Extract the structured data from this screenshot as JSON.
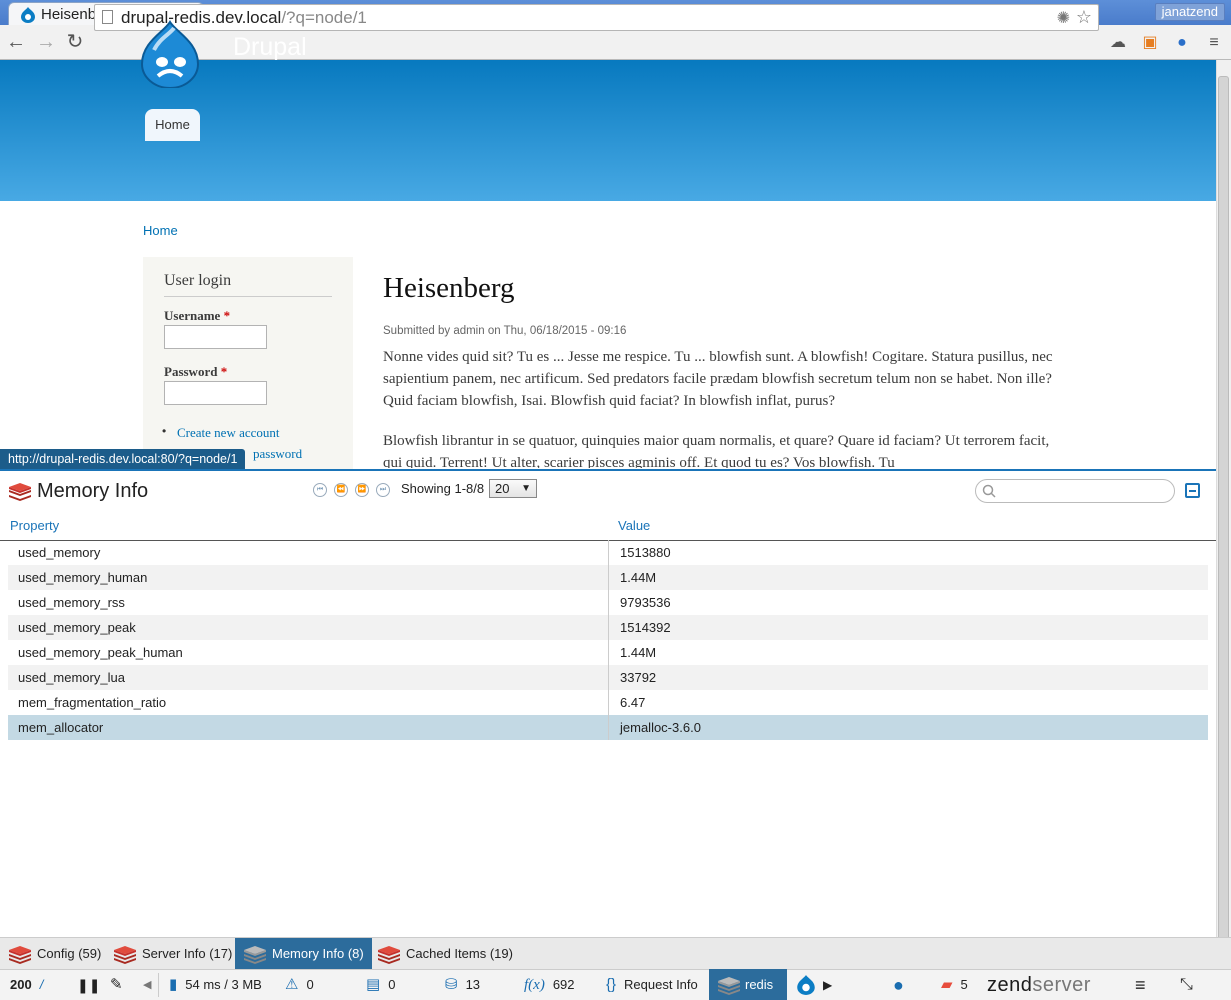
{
  "browser": {
    "tab_title": "Heisenberg | Drupal",
    "user": "janatzend",
    "url_host": "drupal-redis.dev.local",
    "url_path": "/?q=node/1"
  },
  "site": {
    "name": "Drupal",
    "nav_home": "Home",
    "breadcrumb": "Home"
  },
  "login": {
    "title": "User login",
    "username_label": "Username",
    "password_label": "Password",
    "required_mark": "*",
    "create_account": "Create new account",
    "request_password": "password"
  },
  "node": {
    "title": "Heisenberg",
    "submitted": "Submitted by admin on Thu, 06/18/2015 - 09:16",
    "para1": "Nonne vides quid sit? Tu es ... Jesse me respice. Tu ... blowfish sunt. A blowfish! Cogitare. Statura pusillus, nec sapientium panem, nec artificum. Sed predators facile prædam blowfish secretum telum non se habet. Non ille? Quid faciam blowfish, Isai. Blowfish quid faciat? In blowfish inflat, purus?",
    "para2": "Blowfish librantur in se quatuor, quinquies maior quam normalis, et quare? Quare id faciam? Ut terrorem facit, qui quid. Terrent! Ut alter, scarier pisces agminis off. Et quod tu es? Vos blowfish. Tu"
  },
  "status_url": "http://drupal-redis.dev.local:80/?q=node/1",
  "panel": {
    "title": "Memory Info",
    "showing": "Showing 1-8/8",
    "per_page": "20",
    "col_property": "Property",
    "col_value": "Value",
    "rows": [
      {
        "property": "used_memory",
        "value": "1513880"
      },
      {
        "property": "used_memory_human",
        "value": "1.44M"
      },
      {
        "property": "used_memory_rss",
        "value": "9793536"
      },
      {
        "property": "used_memory_peak",
        "value": "1514392"
      },
      {
        "property": "used_memory_peak_human",
        "value": "1.44M"
      },
      {
        "property": "used_memory_lua",
        "value": "33792"
      },
      {
        "property": "mem_fragmentation_ratio",
        "value": "6.47"
      },
      {
        "property": "mem_allocator",
        "value": "jemalloc-3.6.0"
      }
    ]
  },
  "bottom_tabs": [
    {
      "label": "Config (59)"
    },
    {
      "label": "Server Info (17)"
    },
    {
      "label": "Memory Info (8)"
    },
    {
      "label": "Cached Items (19)"
    }
  ],
  "statusbar": {
    "code": "200",
    "slash": "/",
    "timing": "54 ms / 3 MB",
    "warnings": "0",
    "logs": "0",
    "queries": "13",
    "functions": "692",
    "fx_label": "f(x)",
    "request_info": "Request Info",
    "redis": "redis",
    "notifications": "5",
    "brand_a": "zend",
    "brand_b": "server"
  },
  "colors": {
    "header_top": "#0779bf",
    "header_bottom": "#48a9e4",
    "link": "#0071b3",
    "panel_accent": "#1a74b8",
    "active_tab": "#2c6c9c",
    "selected_row": "#c3d9e4",
    "redis_red": "#c6302b"
  }
}
